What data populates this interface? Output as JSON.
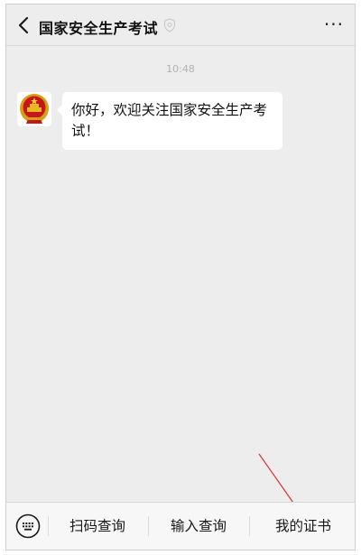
{
  "header": {
    "title": "国家安全生产考试",
    "back_icon": "chevron-left-icon",
    "verified_icon": "verified-badge-icon",
    "more_label": "···"
  },
  "chat": {
    "timestamp": "10:48",
    "messages": [
      {
        "sender_avatar": "national-emblem-avatar",
        "text": "你好，欢迎关注国家安全生产考试！"
      }
    ]
  },
  "menu": {
    "keyboard_icon": "keyboard-icon",
    "items": [
      {
        "label": "扫码查询"
      },
      {
        "label": "输入查询"
      },
      {
        "label": "我的证书"
      }
    ]
  },
  "annotation": {
    "arrow_color": "#e03030"
  },
  "colors": {
    "background": "#ededed",
    "bubble": "#ffffff",
    "menubar": "#f7f7f7"
  }
}
